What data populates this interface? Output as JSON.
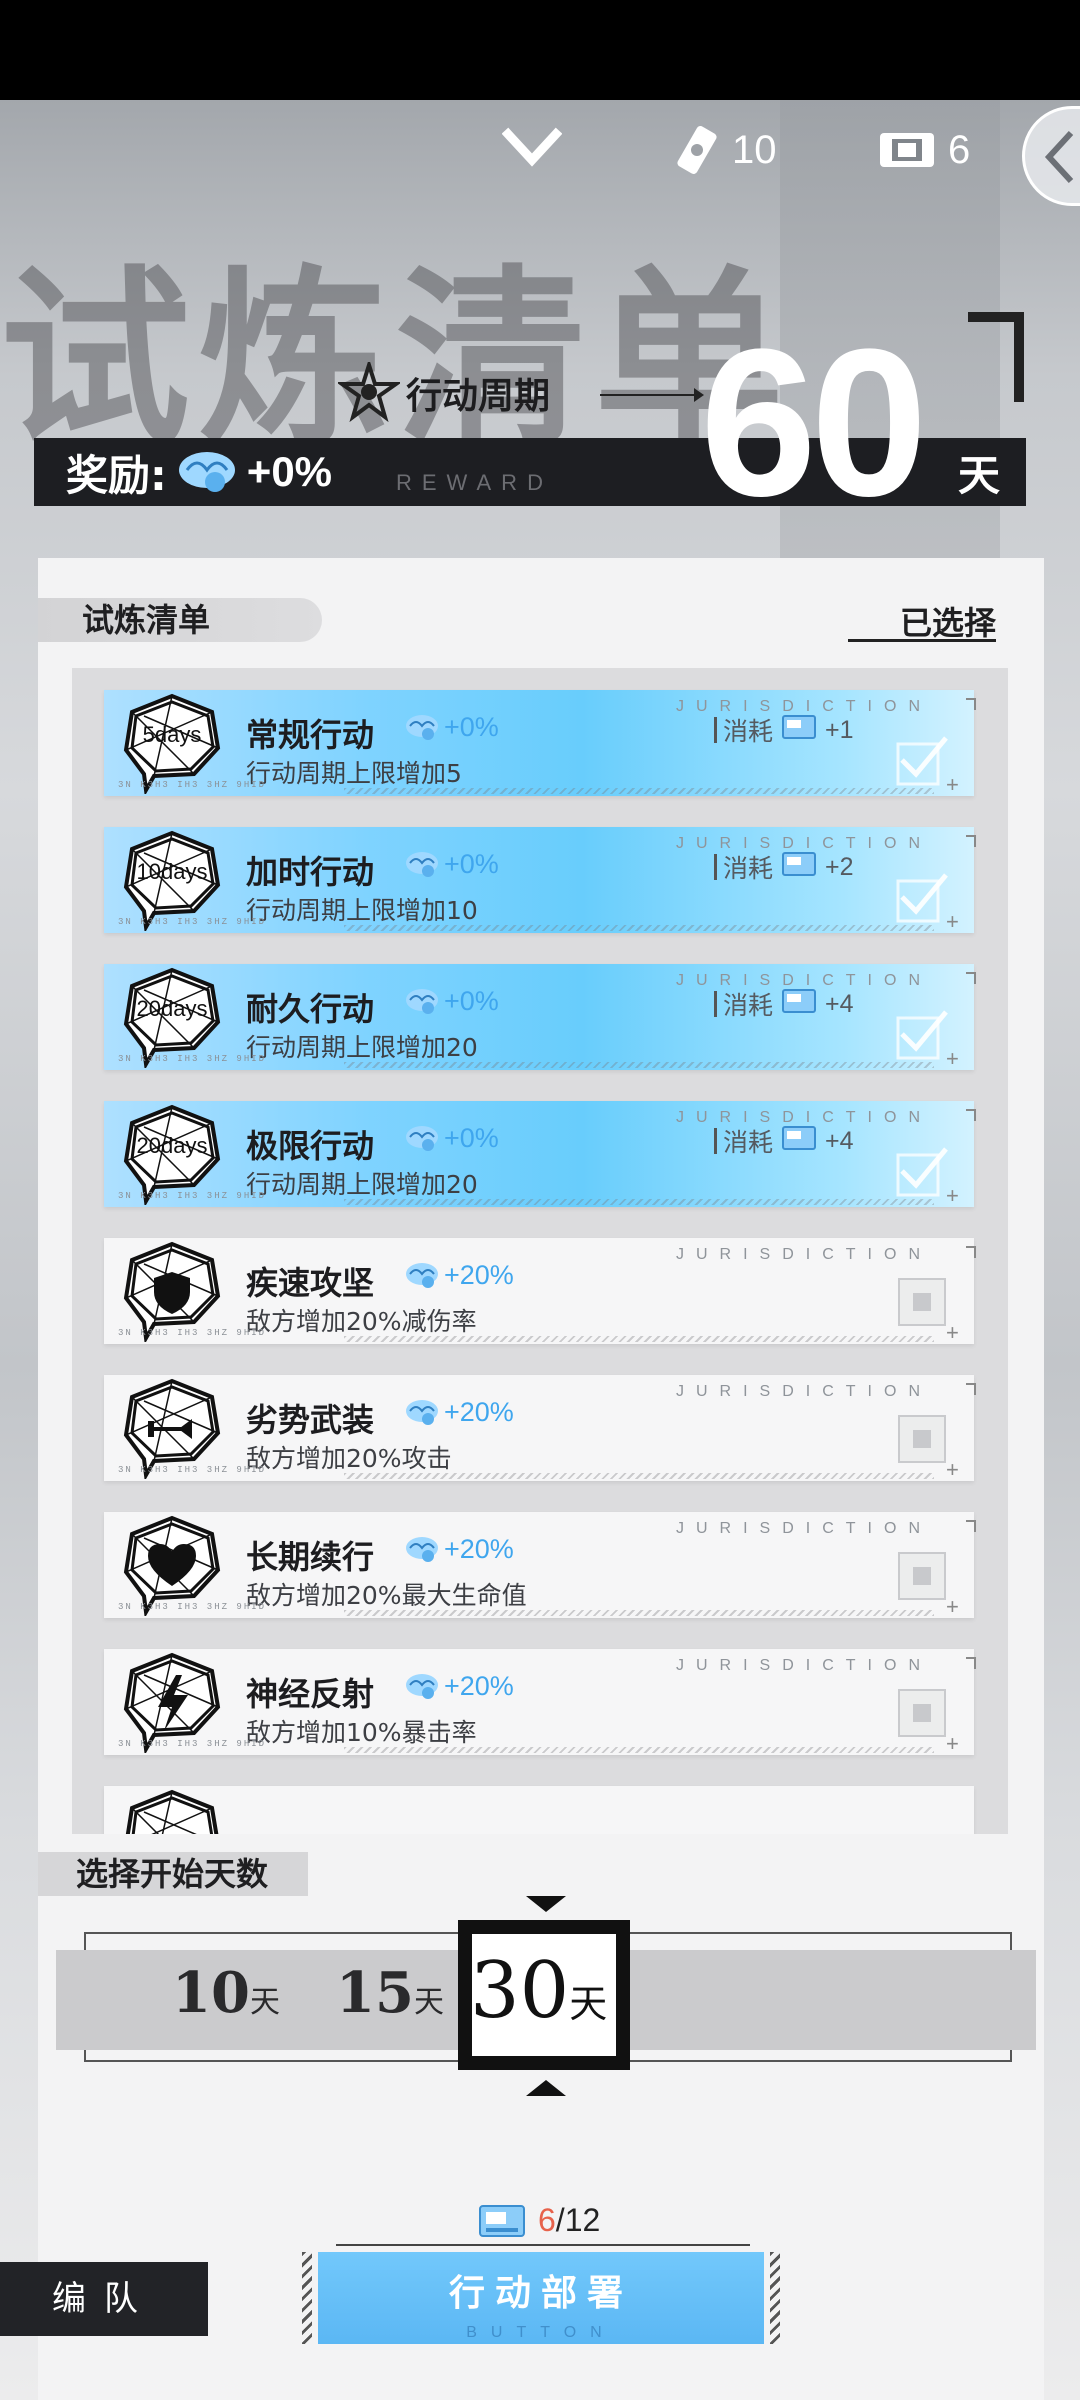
{
  "background_title": "试炼清单",
  "header": {
    "collapse_icon": "chevron-down-icon",
    "resource1_value": "10",
    "resource2_value": "6"
  },
  "cycle": {
    "label": "行动周期",
    "value": "60",
    "unit": "天"
  },
  "reward": {
    "label": "奖励:",
    "value": "+0%",
    "en_text": "REWARD"
  },
  "panel": {
    "section_title": "试炼清单",
    "selected_link": "已选择"
  },
  "items": [
    {
      "badge": "5days",
      "title": "常规行动",
      "bonus": "+0%",
      "desc": "行动周期上限增加5",
      "cost_label": "消耗",
      "cost": "+1",
      "selected": true
    },
    {
      "badge": "10days",
      "title": "加时行动",
      "bonus": "+0%",
      "desc": "行动周期上限增加10",
      "cost_label": "消耗",
      "cost": "+2",
      "selected": true
    },
    {
      "badge": "20days",
      "title": "耐久行动",
      "bonus": "+0%",
      "desc": "行动周期上限增加20",
      "cost_label": "消耗",
      "cost": "+4",
      "selected": true
    },
    {
      "badge": "20days",
      "title": "极限行动",
      "bonus": "+0%",
      "desc": "行动周期上限增加20",
      "cost_label": "消耗",
      "cost": "+4",
      "selected": true
    },
    {
      "badge": "",
      "title": "疾速攻坚",
      "bonus": "+20%",
      "desc": "敌方增加20%减伤率",
      "selected": false,
      "icon": "shield-icon"
    },
    {
      "badge": "",
      "title": "劣势武装",
      "bonus": "+20%",
      "desc": "敌方增加20%攻击",
      "selected": false,
      "icon": "sword-icon"
    },
    {
      "badge": "",
      "title": "长期续行",
      "bonus": "+20%",
      "desc": "敌方增加20%最大生命值",
      "selected": false,
      "icon": "heart-icon"
    },
    {
      "badge": "",
      "title": "神经反射",
      "bonus": "+20%",
      "desc": "敌方增加10%暴击率",
      "selected": false,
      "icon": "lightning-icon"
    }
  ],
  "item_en_text": "JURISDICTION",
  "day_select": {
    "title": "选择开始天数",
    "options": [
      {
        "value": "10",
        "unit": "天"
      },
      {
        "value": "15",
        "unit": "天"
      },
      {
        "value": "30",
        "unit": "天"
      }
    ],
    "selected": "30"
  },
  "tickets": {
    "current": "6",
    "total": "/12"
  },
  "deploy_button": {
    "label": "行动部署",
    "en_text": "BUTTON"
  },
  "team_button": {
    "label": "编队"
  },
  "colors": {
    "accent_blue": "#5bb7f4",
    "bonus_blue": "#3fa6ee",
    "ticket_red": "#e7624b"
  }
}
